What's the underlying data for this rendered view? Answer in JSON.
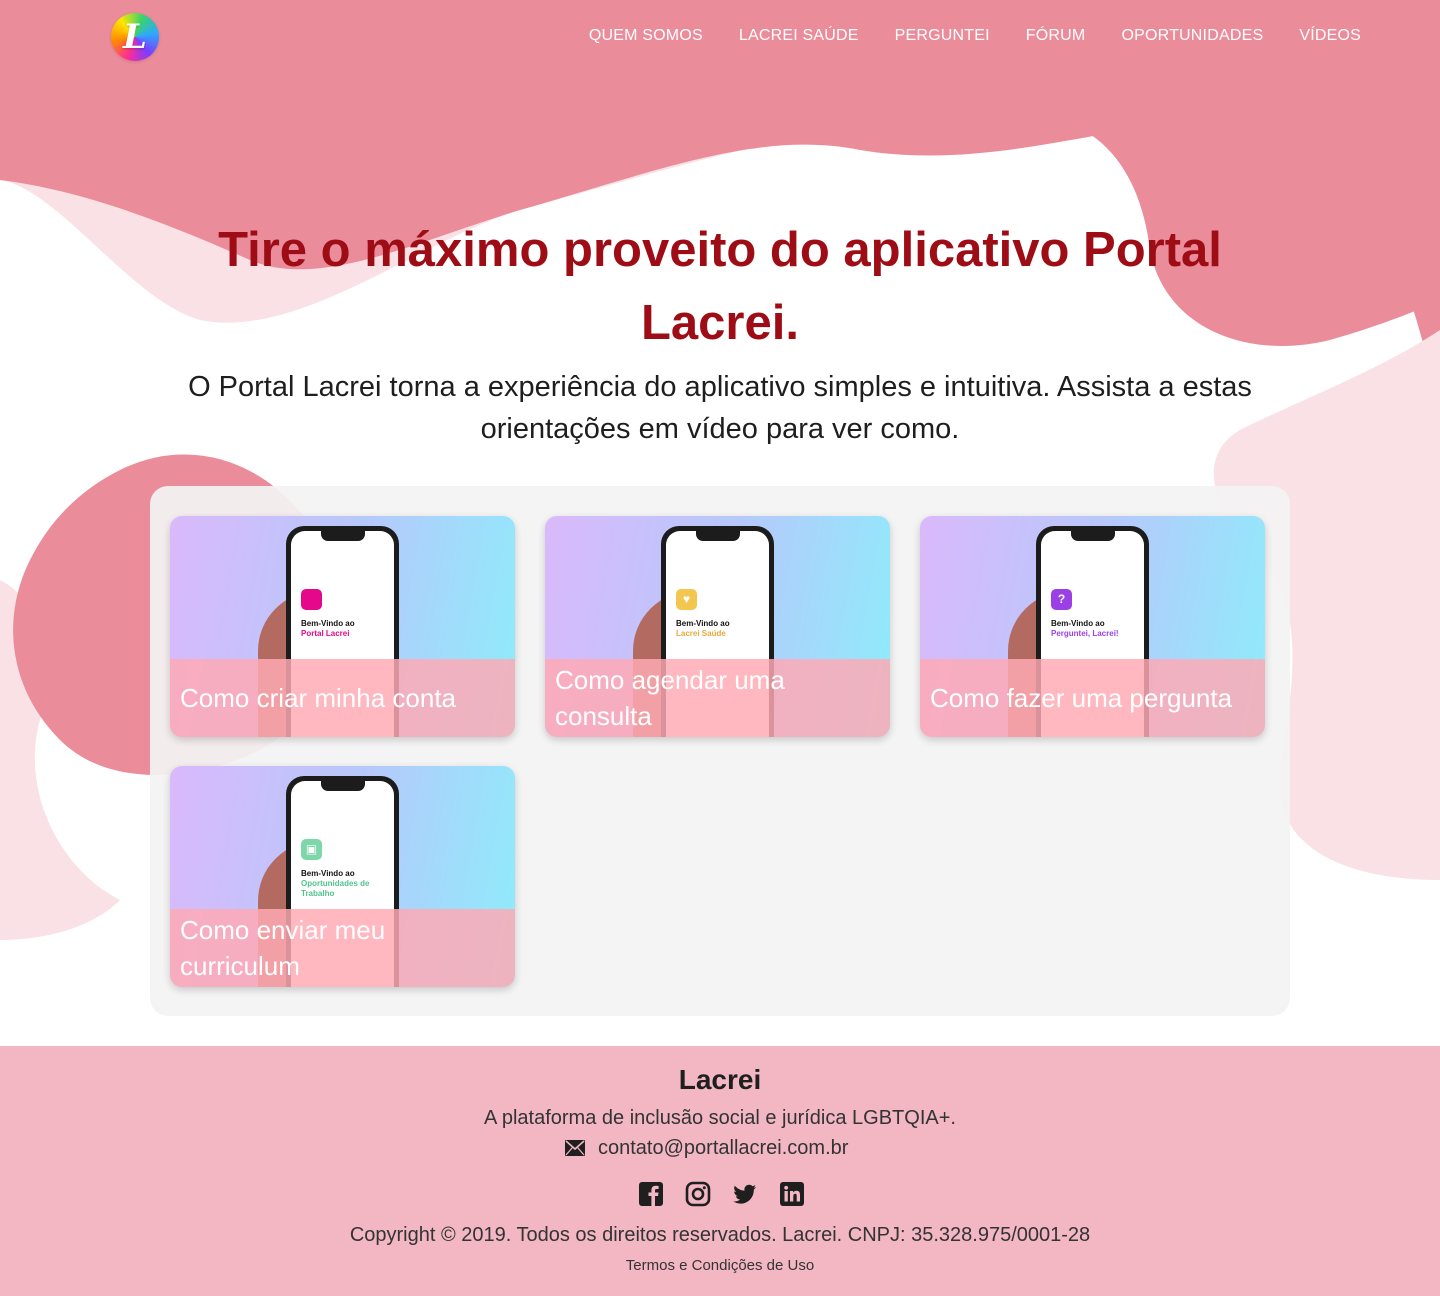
{
  "header": {
    "logo_letter": "L",
    "nav": [
      "QUEM SOMOS",
      "LACREI SAÚDE",
      "PERGUNTEI",
      "FÓRUM",
      "OPORTUNIDADES",
      "VÍDEOS"
    ]
  },
  "hero": {
    "title": "Tire o máximo proveito do aplicativo Portal Lacrei.",
    "subtitle": "O Portal Lacrei torna a experiência do aplicativo simples e intuitiva. Assista a estas orientações em vídeo para ver como."
  },
  "videos": [
    {
      "title": "Como criar minha conta",
      "screen_title": "Bem-Vindo ao",
      "screen_app": "Portal Lacrei",
      "icon_color": "#e5088b",
      "icon": ""
    },
    {
      "title": "Como agendar uma consulta",
      "screen_title": "Bem-Vindo ao",
      "screen_app": "Lacrei Saúde",
      "icon_color": "#f3c650",
      "icon": "♥"
    },
    {
      "title": "Como fazer uma pergunta",
      "screen_title": "Bem-Vindo ao",
      "screen_app": "Perguntei, Lacrei!",
      "icon_color": "#9b3fe6",
      "icon": "?"
    },
    {
      "title": "Como enviar meu curriculum",
      "screen_title": "Bem-Vindo ao",
      "screen_app": "Oportunidades de Trabalho",
      "icon_color": "#7ed7a8",
      "icon": "▣"
    }
  ],
  "footer": {
    "brand": "Lacrei",
    "tagline": "A plataforma de inclusão social e jurídica LGBTQIA+.",
    "email": "contato@portallacrei.com.br",
    "copyright": "Copyright © 2019. Todos os direitos reservados. Lacrei. CNPJ: 35.328.975/0001-28",
    "terms": "Termos e Condições de Uso"
  },
  "colors": {
    "pink_dark": "#eb8c9b",
    "pink_light": "#f9e1e5",
    "title_red": "#9e0d16",
    "footer_bg": "#f2b7c3"
  },
  "icons": [
    "envelope-icon",
    "facebook-icon",
    "instagram-icon",
    "twitter-icon",
    "linkedin-icon"
  ]
}
